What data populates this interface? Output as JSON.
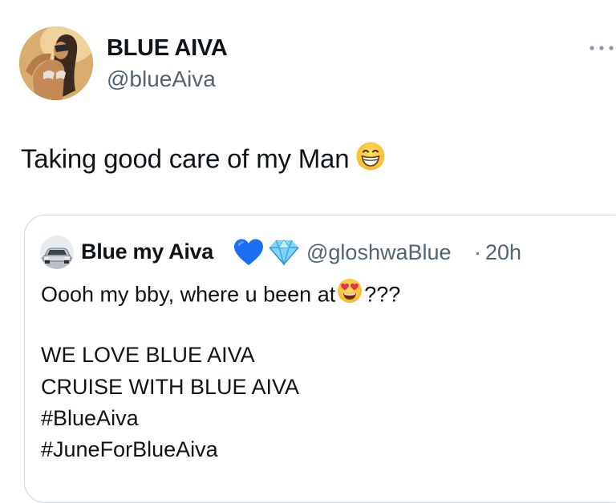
{
  "author": {
    "display_name": "BLUE AIVA",
    "handle": "@blueAiva",
    "avatar_icon": "profile-photo"
  },
  "menu": {
    "icon": "more-dots-icon"
  },
  "tweet": {
    "text": "Taking good care of my Man",
    "emoji": "grinning-face-emoji"
  },
  "quoted": {
    "display_name": "Blue my Aiva",
    "badges": [
      "blue-heart-emoji",
      "gem-stone-emoji"
    ],
    "handle": "@gloshwaBlue",
    "separator": "·",
    "time": "20h",
    "line1_before": "Oooh my bby, where u been at",
    "line1_emoji": "heart-eyes-emoji",
    "line1_after": "???",
    "lines": [
      "WE LOVE BLUE AIVA",
      "CRUISE WITH BLUE AIVA",
      "#BlueAiva",
      "#JuneForBlueAiva"
    ]
  },
  "colors": {
    "text": "#0f1419",
    "secondary": "#536471",
    "border": "#cfd9de",
    "heart": "#1d6ff2"
  }
}
